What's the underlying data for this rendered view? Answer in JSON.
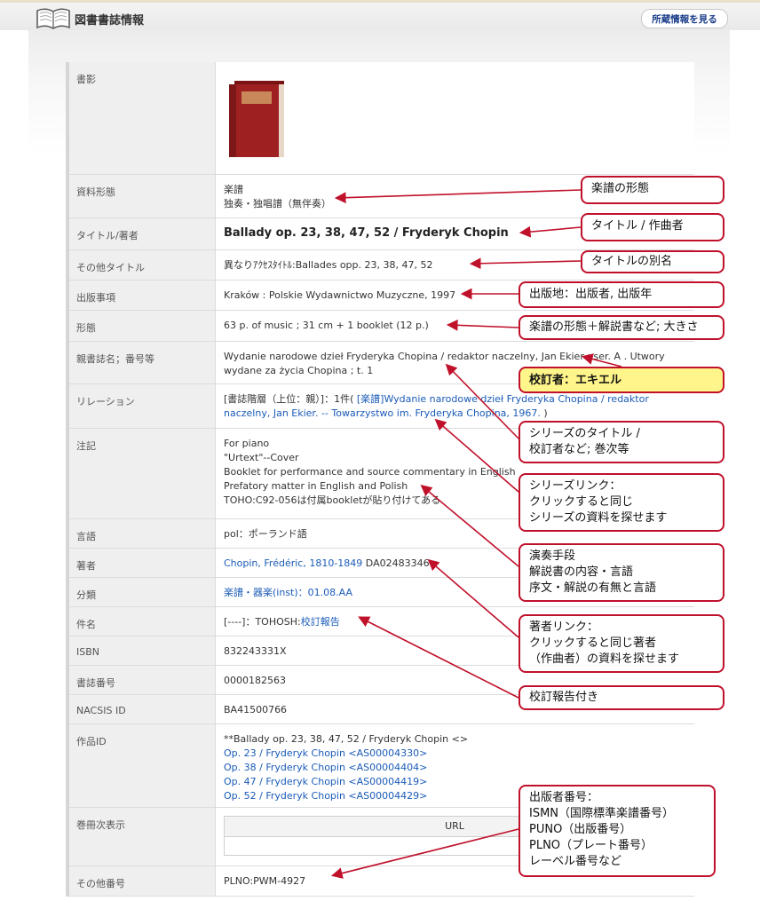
{
  "header": {
    "title": "図書書誌情報",
    "holdings_button": "所蔵情報を見る",
    "colors": {
      "callout_border": "#c0112b",
      "link": "#1a5bb8",
      "highlight": "#fff58a"
    }
  },
  "record": {
    "cover_label": "書影",
    "material_label": "資料形態",
    "material_line1": "楽譜",
    "material_line2": "独奏・独唱譜（無伴奏）",
    "title_label": "タイトル/著者",
    "title_value": "Ballady op. 23, 38, 47, 52 / Fryderyk Chopin",
    "other_title_label": "その他タイトル",
    "other_title_value": "異なりｱｸｾｽﾀｲﾄﾙ:Ballades opp. 23, 38, 47, 52",
    "publication_label": "出版事項",
    "publication_value": "Kraków : Polskie Wydawnictwo Muzyczne, 1997",
    "form_label": "形態",
    "form_value": "63 p. of music ; 31 cm + 1 booklet (12 p.)",
    "series_label": "親書誌名；番号等",
    "series_value": "Wydanie narodowe dzieł Fryderyka Chopina / redaktor naczelny, Jan Ekier ; ser. A . Utwory wydane za życia Chopina ; t. 1",
    "relation_label": "リレーション",
    "relation_prefix": "[書誌階層（上位：親）]：1件(",
    "relation_link": "[楽譜]Wydanie narodowe dzieł Fryderyka Chopina / redaktor naczelny, Jan Ekier. -- Towarzystwo im. Fryderyka Chopina, 1967.",
    "relation_suffix": ")",
    "notes_label": "注記",
    "notes": [
      "For piano",
      "\"Urtext\"--Cover",
      "Booklet for performance and source commentary in English",
      "Prefatory matter in English and Polish",
      "TOHO:C92-056は付属bookletが貼り付けてある"
    ],
    "language_label": "言語",
    "language_value": "pol：ポーランド語",
    "author_label": "著者",
    "author_link": "Chopin, Frédéric, 1810-1849",
    "author_id": "DA02483346",
    "class_label": "分類",
    "class_link": "楽譜・器楽(inst)：01.08.AA",
    "subject_label": "件名",
    "subject_prefix": "[----]：TOHOSH:",
    "subject_link": "校訂報告",
    "isbn_label": "ISBN",
    "isbn_value": "832243331X",
    "bib_label": "書誌番号",
    "bib_value": "0000182563",
    "nacsis_label": "NACSIS ID",
    "nacsis_value": "BA41500766",
    "work_label": "作品ID",
    "work_first": "**Ballady op. 23, 38, 47, 52 / Fryderyk Chopin <>",
    "work_links": [
      "Op. 23 / Fryderyk Chopin <AS00004330>",
      "Op. 38 / Fryderyk Chopin <AS00004404>",
      "Op. 47 / Fryderyk Chopin <AS00004419>",
      "Op. 52 / Fryderyk Chopin <AS00004429>"
    ],
    "volumes_label": "巻冊次表示",
    "url_header": "URL",
    "other_number_label": "その他番号",
    "other_number_value": "PLNO:PWM-4927"
  },
  "callouts": {
    "material": "楽譜の形態",
    "title": "タイトル / 作曲者",
    "alt_title": "タイトルの別名",
    "publication": "出版地：出版者, 出版年",
    "form": "楽譜の形態＋解説書など; 大きさ",
    "editor": "校訂者：エキエル",
    "series": [
      "シリーズのタイトル /",
      "校訂者など; 巻次等"
    ],
    "series_link": [
      "シリーズリンク：",
      "クリックすると同じ",
      "シリーズの資料を探せます"
    ],
    "notes": [
      "演奏手段",
      "解説書の内容・言語",
      "序文・解説の有無と言語"
    ],
    "author_link": [
      "著者リンク：",
      "クリックすると同じ著者",
      "（作曲者）の資料を探せます"
    ],
    "revision": "校訂報告付き",
    "publisher_numbers": [
      "出版者番号：",
      "ISMN（国際標準楽譜番号）",
      "PUNO（出版番号）",
      "PLNO（プレート番号）",
      "レーベル番号など"
    ]
  }
}
